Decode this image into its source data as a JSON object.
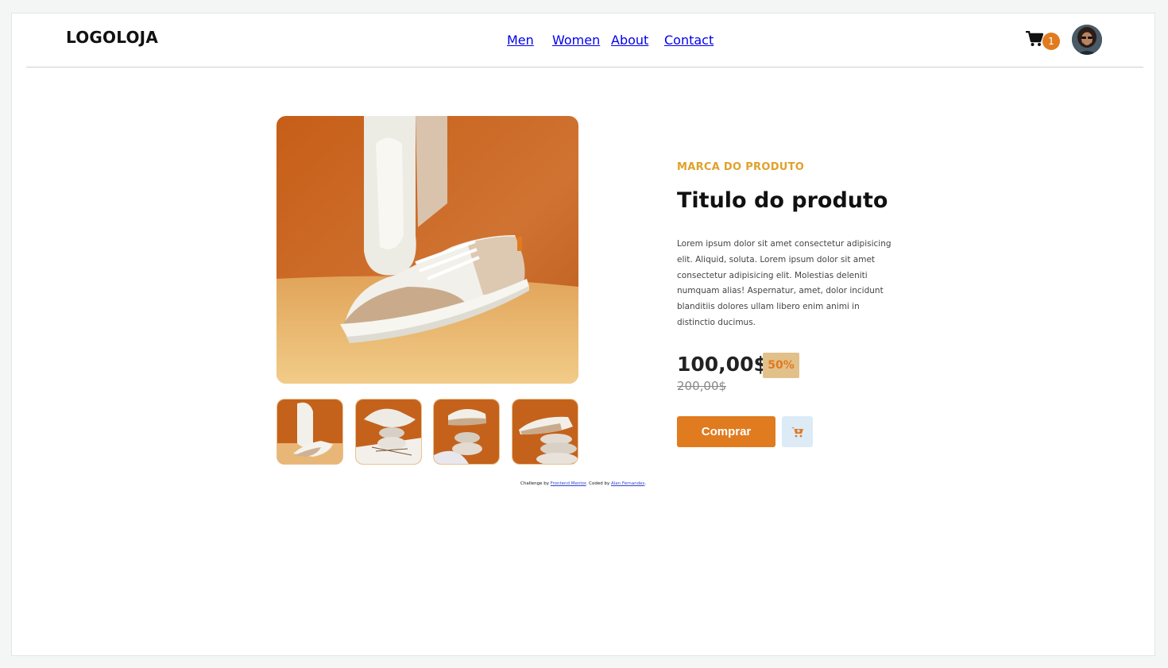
{
  "header": {
    "logo": "LOGOLOJA",
    "nav": [
      {
        "label": "Men"
      },
      {
        "label": "Women"
      },
      {
        "label": "About"
      },
      {
        "label": "Contact"
      }
    ],
    "cart_count": "1"
  },
  "product": {
    "brand": "MARCA DO PRODUTO",
    "title": "Titulo do produto",
    "description": "Lorem ipsum dolor sit amet consectetur adipisicing elit. Aliquid, soluta. Lorem ipsum dolor sit amet consectetur adipisicing elit. Molestias deleniti numquam alias! Aspernatur, amet, dolor incidunt blanditiis dolores ullam libero enim animi in distinctio ducimus.",
    "price": "100,00$",
    "discount": "50%",
    "old_price": "200,00$",
    "buy_label": "Comprar"
  },
  "attribution": {
    "prefix": "Challenge by ",
    "link1": "Frontend Mentor",
    "middle": ". Coded by ",
    "link2": "Alan Fernandes",
    "suffix": "."
  },
  "colors": {
    "accent": "#e07b1f",
    "brand_text": "#e0a12a",
    "discount_bg": "#e2c08a",
    "cart_button_bg": "#dcebf6"
  },
  "icons": {
    "cart": "cart-icon",
    "add_to_cart": "add-to-cart-icon"
  }
}
